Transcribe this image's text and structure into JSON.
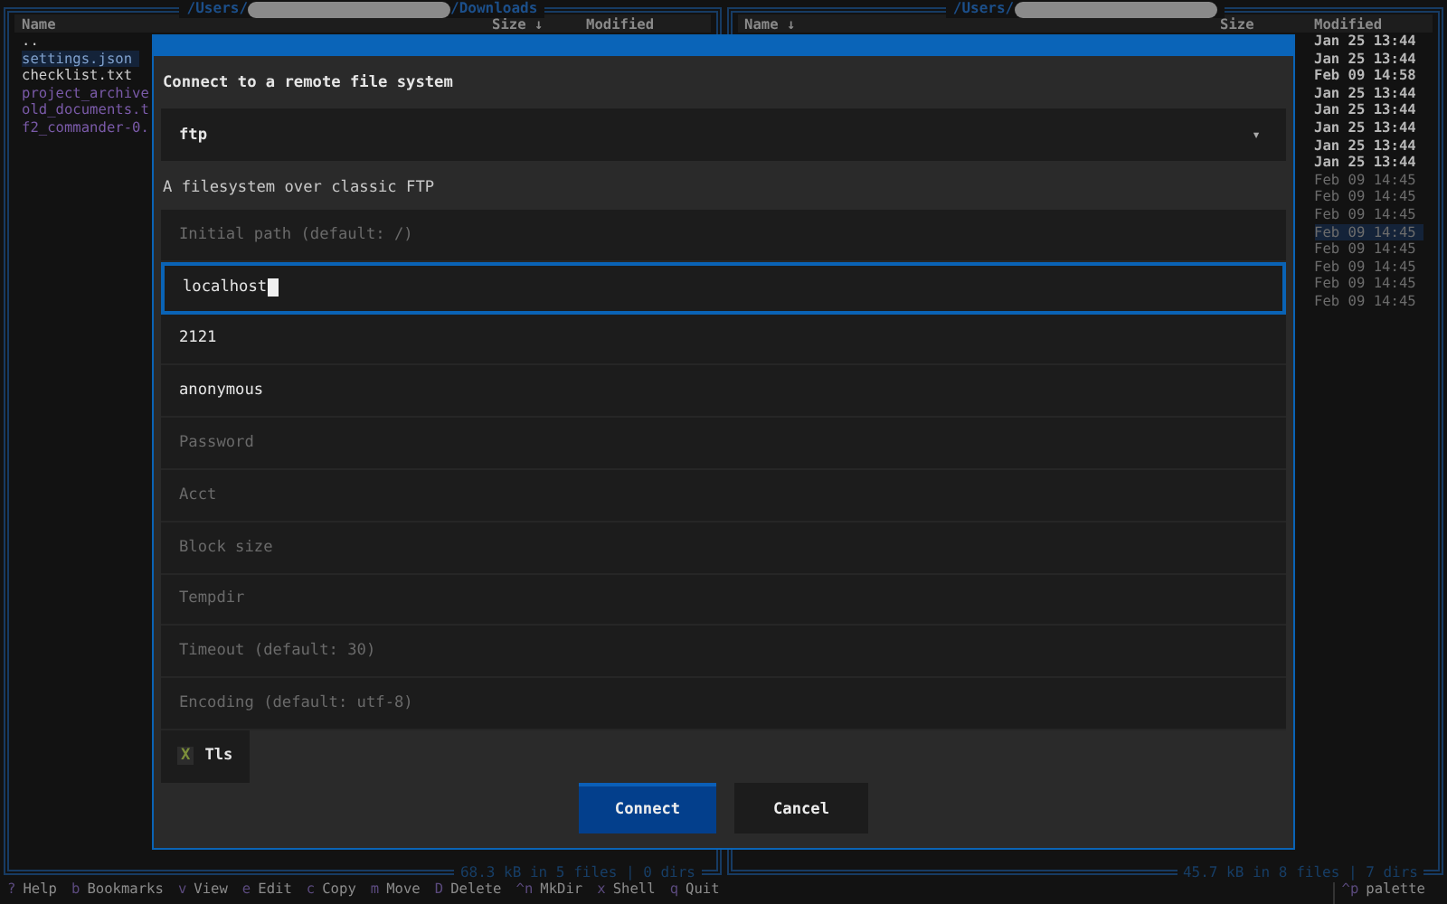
{
  "left_panel": {
    "title_start": "/Users/",
    "title_end": "/Downloads",
    "columns": [
      "Name",
      "Size ↓",
      "Modified"
    ],
    "rows": [
      {
        "name": "..",
        "kind": "file",
        "selected": false
      },
      {
        "name": "settings.json",
        "kind": "file",
        "selected": true
      },
      {
        "name": "checklist.txt",
        "kind": "file",
        "selected": false
      },
      {
        "name": "project_archive",
        "kind": "archive",
        "selected": false
      },
      {
        "name": "old_documents.t",
        "kind": "archive",
        "selected": false
      },
      {
        "name": "f2_commander-0.",
        "kind": "archive",
        "selected": false
      }
    ],
    "status": "68.3 kB in 5 files | 0 dirs"
  },
  "right_panel": {
    "title_start": "/Users/",
    "columns": [
      "Name ↓",
      "Size",
      "Modified"
    ],
    "rows": [
      {
        "modified": "Jan 25 13:44",
        "kind": "dir",
        "selected": false
      },
      {
        "modified": "Jan 25 13:44",
        "kind": "dir",
        "selected": false
      },
      {
        "modified": "Feb 09 14:58",
        "kind": "dir",
        "selected": false
      },
      {
        "modified": "Jan 25 13:44",
        "kind": "dir",
        "selected": false
      },
      {
        "modified": "Jan 25 13:44",
        "kind": "dir",
        "selected": false
      },
      {
        "modified": "Jan 25 13:44",
        "kind": "dir",
        "selected": false
      },
      {
        "modified": "Jan 25 13:44",
        "kind": "dir",
        "selected": false
      },
      {
        "modified": "Jan 25 13:44",
        "kind": "dir",
        "selected": false
      },
      {
        "modified": "Feb 09 14:45",
        "kind": "file",
        "selected": false
      },
      {
        "modified": "Feb 09 14:45",
        "kind": "file",
        "selected": false
      },
      {
        "modified": "Feb 09 14:45",
        "kind": "file",
        "selected": false
      },
      {
        "modified": "Feb 09 14:45",
        "kind": "file",
        "selected": true
      },
      {
        "modified": "Feb 09 14:45",
        "kind": "file",
        "selected": false
      },
      {
        "modified": "Feb 09 14:45",
        "kind": "file",
        "selected": false
      },
      {
        "modified": "Feb 09 14:45",
        "kind": "file",
        "selected": false
      },
      {
        "modified": "Feb 09 14:45",
        "kind": "file",
        "selected": false
      }
    ],
    "status": "45.7 kB in 8 files | 7 dirs"
  },
  "dialog": {
    "title": "Connect to a remote file system",
    "protocol": {
      "value": "ftp",
      "arrow": "▾"
    },
    "description": "A filesystem over classic FTP",
    "fields": [
      {
        "placeholder": "Initial path (default: /)",
        "focused": false
      },
      {
        "value": "localhost",
        "focused": true
      },
      {
        "value": "2121",
        "focused": false
      },
      {
        "value": "anonymous",
        "focused": false
      },
      {
        "placeholder": "Password",
        "focused": false
      },
      {
        "placeholder": "Acct",
        "focused": false
      },
      {
        "placeholder": "Block size",
        "focused": false
      },
      {
        "placeholder": "Tempdir",
        "focused": false
      },
      {
        "placeholder": "Timeout (default: 30)",
        "focused": false
      },
      {
        "placeholder": "Encoding (default: utf-8)",
        "focused": false
      }
    ],
    "checkbox": {
      "mark": "X",
      "label": "Tls",
      "checked": true
    },
    "buttons": [
      {
        "label": "Connect",
        "selected": true
      },
      {
        "label": "Cancel",
        "selected": false
      }
    ]
  },
  "footer": {
    "keys": [
      {
        "key": "?",
        "label": "Help"
      },
      {
        "key": "b",
        "label": "Bookmarks"
      },
      {
        "key": "v",
        "label": "View"
      },
      {
        "key": "e",
        "label": "Edit"
      },
      {
        "key": "c",
        "label": "Copy"
      },
      {
        "key": "m",
        "label": "Move"
      },
      {
        "key": "D",
        "label": "Delete"
      },
      {
        "key": "^n",
        "label": "MkDir"
      },
      {
        "key": "x",
        "label": "Shell"
      },
      {
        "key": "q",
        "label": "Quit"
      }
    ],
    "palette": {
      "key": "^p",
      "label": "palette"
    }
  }
}
